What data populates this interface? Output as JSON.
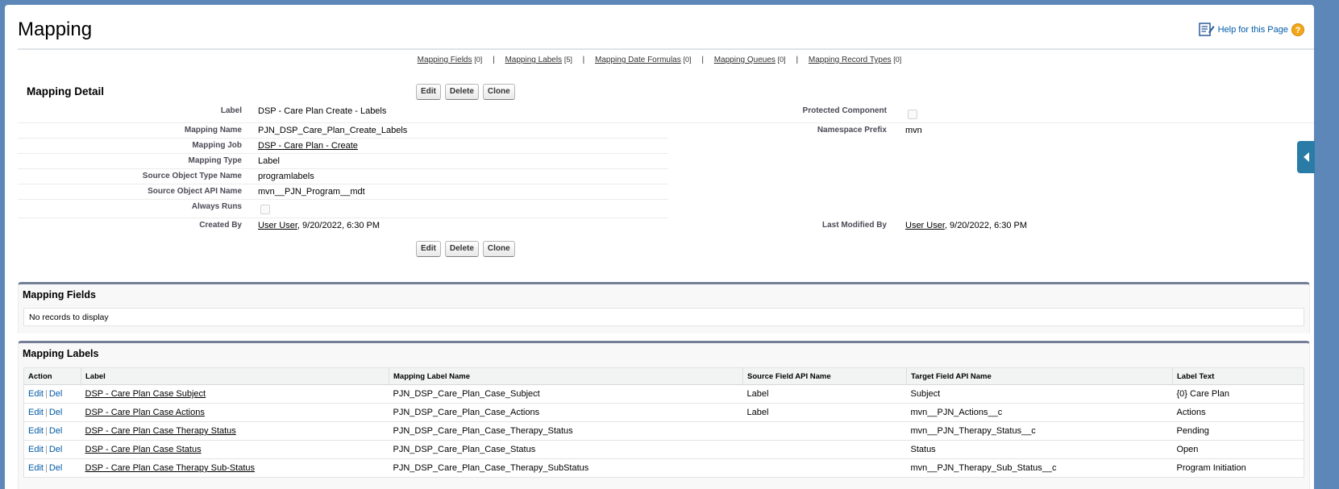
{
  "page": {
    "title": "Mapping",
    "help_link": "Help for this Page"
  },
  "related_links": [
    {
      "label": "Mapping Fields",
      "count": "[0]"
    },
    {
      "label": "Mapping Labels",
      "count": "[5]"
    },
    {
      "label": "Mapping Date Formulas",
      "count": "[0]"
    },
    {
      "label": "Mapping Queues",
      "count": "[0]"
    },
    {
      "label": "Mapping Record Types",
      "count": "[0]"
    }
  ],
  "detail": {
    "title": "Mapping Detail",
    "buttons": {
      "edit": "Edit",
      "delete": "Delete",
      "clone": "Clone"
    },
    "fields": {
      "label": {
        "label": "Label",
        "value": "DSP - Care Plan Create - Labels"
      },
      "protected": {
        "label": "Protected Component",
        "checked": false
      },
      "mapping_name": {
        "label": "Mapping Name",
        "value": "PJN_DSP_Care_Plan_Create_Labels"
      },
      "namespace": {
        "label": "Namespace Prefix",
        "value": "mvn"
      },
      "mapping_job": {
        "label": "Mapping Job",
        "value": "DSP - Care Plan - Create"
      },
      "mapping_type": {
        "label": "Mapping Type",
        "value": "Label"
      },
      "source_type_name": {
        "label": "Source Object Type Name",
        "value": "programlabels"
      },
      "source_api_name": {
        "label": "Source Object API Name",
        "value": "mvn__PJN_Program__mdt"
      },
      "always_runs": {
        "label": "Always Runs",
        "checked": false
      },
      "created_by": {
        "label": "Created By",
        "user": "User User",
        "date": ", 9/20/2022, 6:30 PM"
      },
      "modified_by": {
        "label": "Last Modified By",
        "user": "User User",
        "date": ", 9/20/2022, 6:30 PM"
      }
    }
  },
  "mapping_fields": {
    "title": "Mapping Fields",
    "empty": "No records to display"
  },
  "mapping_labels": {
    "title": "Mapping Labels",
    "columns": [
      "Action",
      "Label",
      "Mapping Label Name",
      "Source Field API Name",
      "Target Field API Name",
      "Label Text"
    ],
    "action_edit": "Edit",
    "action_sep": "|",
    "action_del": "Del",
    "rows": [
      {
        "label": "DSP - Care Plan Case Subject",
        "name": "PJN_DSP_Care_Plan_Case_Subject",
        "source": "Label",
        "target": "Subject",
        "text": "{0} Care Plan"
      },
      {
        "label": "DSP - Care Plan Case Actions",
        "name": "PJN_DSP_Care_Plan_Case_Actions",
        "source": "Label",
        "target": "mvn__PJN_Actions__c",
        "text": "Actions"
      },
      {
        "label": "DSP - Care Plan Case Therapy Status",
        "name": "PJN_DSP_Care_Plan_Case_Therapy_Status",
        "source": "",
        "target": "mvn__PJN_Therapy_Status__c",
        "text": "Pending"
      },
      {
        "label": "DSP - Care Plan Case Status",
        "name": "PJN_DSP_Care_Plan_Case_Status",
        "source": "",
        "target": "Status",
        "text": "Open"
      },
      {
        "label": "DSP - Care Plan Case Therapy Sub-Status",
        "name": "PJN_DSP_Care_Plan_Case_Therapy_SubStatus",
        "source": "",
        "target": "mvn__PJN_Therapy_Sub_Status__c",
        "text": "Program Initiation"
      }
    ]
  },
  "colors": {
    "background": "#5c87b8",
    "link_blue": "#015ba7",
    "section_border": "#747e96",
    "side_tab": "#2a7ba6",
    "help_icon": "#f2a719"
  }
}
